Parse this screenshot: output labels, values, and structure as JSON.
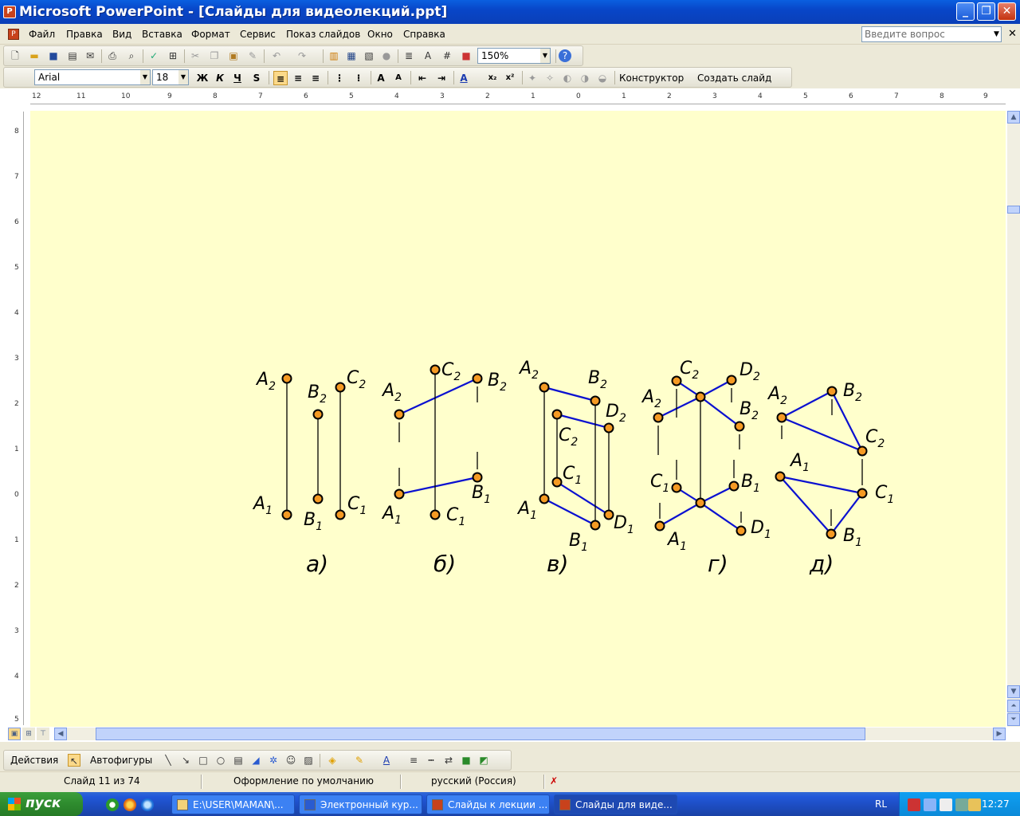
{
  "window": {
    "title": "Microsoft PowerPoint - [Слайды для видеолекций.ppt]",
    "minimize": "_",
    "maximize": "❐",
    "close": "✕"
  },
  "menu": {
    "items": [
      "Файл",
      "Правка",
      "Вид",
      "Вставка",
      "Формат",
      "Сервис",
      "Показ слайдов",
      "Окно",
      "Справка"
    ],
    "ask_placeholder": "Введите вопрос"
  },
  "standard_toolbar": {
    "zoom": "150%"
  },
  "formatting_toolbar": {
    "font": "Arial",
    "size": "18",
    "bold": "Ж",
    "italic": "К",
    "underline": "Ч",
    "shadow": "S",
    "designer": "Конструктор",
    "new_slide": "Создать слайд"
  },
  "rulers": {
    "horizontal": [
      "12",
      "11",
      "10",
      "9",
      "8",
      "7",
      "6",
      "5",
      "4",
      "3",
      "2",
      "1",
      "0",
      "1",
      "2",
      "3",
      "4",
      "5",
      "6",
      "7",
      "8",
      "9"
    ],
    "vertical": [
      "8",
      "7",
      "6",
      "5",
      "4",
      "3",
      "2",
      "1",
      "0",
      "1",
      "2",
      "3",
      "4",
      "5"
    ]
  },
  "slide": {
    "background": "#ffffcc",
    "line_color": "#0a10d0",
    "point_fill": "#f59a23",
    "captions": [
      "а)",
      "б)",
      "в)",
      "г)",
      "д)"
    ],
    "fig_a": {
      "labels": [
        "A",
        "B",
        "C",
        "A",
        "B",
        "C"
      ],
      "subs": [
        "2",
        "2",
        "2",
        "1",
        "1",
        "1"
      ]
    },
    "fig_b": {
      "labels": [
        "A",
        "B",
        "C",
        "A",
        "B",
        "C"
      ],
      "subs": [
        "2",
        "2",
        "2",
        "1",
        "1",
        "1"
      ]
    },
    "fig_v": {
      "labels": [
        "A",
        "B",
        "C",
        "D",
        "A",
        "B",
        "C",
        "D"
      ],
      "subs": [
        "2",
        "2",
        "2",
        "2",
        "1",
        "1",
        "1",
        "1"
      ]
    },
    "fig_g": {
      "labels": [
        "A",
        "B",
        "C",
        "D",
        "A",
        "B",
        "C",
        "D"
      ],
      "subs": [
        "2",
        "2",
        "2",
        "2",
        "1",
        "1",
        "1",
        "1"
      ]
    },
    "fig_d": {
      "labels": [
        "A",
        "B",
        "C",
        "A",
        "B",
        "C"
      ],
      "subs": [
        "2",
        "2",
        "2",
        "1",
        "1",
        "1"
      ]
    }
  },
  "drawing_toolbar": {
    "actions": "Действия",
    "autoshapes": "Автофигуры"
  },
  "status": {
    "slide": "Слайд 11 из 74",
    "design": "Оформление по умолчанию",
    "language": "русский (Россия)"
  },
  "taskbar": {
    "start": "пуск",
    "tasks": [
      "E:\\USER\\MAMAN\\...",
      "Электронный кур...",
      "Слайды к лекции ...",
      "Слайды для виде..."
    ],
    "lang": "RL",
    "clock": "12:27"
  }
}
